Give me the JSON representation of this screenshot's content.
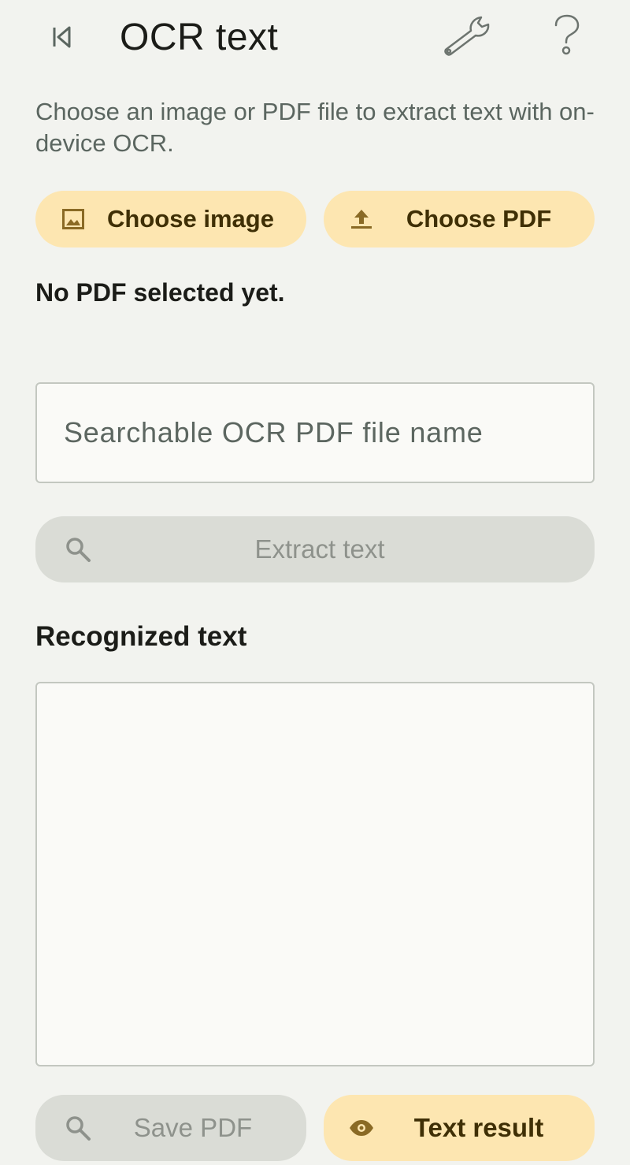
{
  "header": {
    "title": "OCR text",
    "back_icon": "skip-back-icon",
    "settings_icon": "wrench-icon",
    "help_icon": "help-question-icon"
  },
  "description": "Choose an image or PDF file to extract text with on-device OCR.",
  "actions": {
    "choose_image_label": "Choose image",
    "choose_image_icon": "image-icon",
    "choose_pdf_label": "Choose PDF",
    "choose_pdf_icon": "upload-icon"
  },
  "status_text": "No PDF selected yet.",
  "filename_field": {
    "placeholder": "Searchable OCR PDF file name",
    "value": ""
  },
  "extract": {
    "label": "Extract text",
    "icon": "search-icon",
    "enabled": false
  },
  "recognized": {
    "title": "Recognized text",
    "value": ""
  },
  "footer": {
    "save_pdf_label": "Save PDF",
    "save_pdf_icon": "search-icon",
    "save_pdf_enabled": false,
    "text_result_label": "Text result",
    "text_result_icon": "eye-icon"
  },
  "colors": {
    "background": "#f2f3ef",
    "amber_button": "#fde6b1",
    "amber_text": "#3f2f05",
    "disabled_button": "#dadcd6",
    "disabled_text": "#8e928c",
    "icon_brown": "#8a6a25"
  }
}
